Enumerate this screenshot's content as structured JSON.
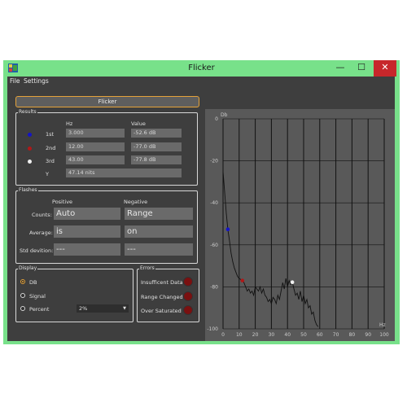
{
  "window": {
    "title": "Flicker",
    "minimize_glyph": "—",
    "maximize_glyph": "☐",
    "close_glyph": "✕"
  },
  "menu": {
    "file": "File",
    "settings": "Settings"
  },
  "flicker_button": "Flicker",
  "results": {
    "label": "Results",
    "col_hz": "Hz",
    "col_value": "Value",
    "rows": [
      {
        "name": "1st",
        "hz": "3.000",
        "value": "-52.6 dB",
        "color": "#1414c8"
      },
      {
        "name": "2nd",
        "hz": "12.00",
        "value": "-77.0 dB",
        "color": "#b01818"
      },
      {
        "name": "3rd",
        "hz": "43.00",
        "value": "-77.8 dB",
        "color": "#f0f0f0"
      }
    ],
    "y_label": "Y",
    "y_value": "47.14 nits"
  },
  "flashes": {
    "label": "Flashes",
    "col_positive": "Positive",
    "col_negative": "Negative",
    "counts_label": "Counts:",
    "counts_pos": "Auto",
    "counts_neg": "Range",
    "average_label": "Average:",
    "average_pos": "is",
    "average_neg": "on",
    "std_label": "Std devition:",
    "std_pos": "---",
    "std_neg": "---"
  },
  "display": {
    "label": "Display",
    "options": [
      "DB",
      "Signal",
      "Percent"
    ],
    "selected": "DB",
    "percent_value": "2%"
  },
  "errors": {
    "label": "Errors",
    "items": [
      "Insufficent Data",
      "Range Changed",
      "Over Saturated"
    ]
  },
  "chart_data": {
    "type": "line",
    "ylabel": "Db",
    "xlabel": "Hz",
    "xlim": [
      0,
      100
    ],
    "ylim": [
      -100,
      0
    ],
    "xticks": [
      0,
      10,
      20,
      30,
      40,
      50,
      60,
      70,
      80,
      90,
      100
    ],
    "yticks": [
      0,
      -20,
      -40,
      -60,
      -80,
      -100
    ],
    "grid": true,
    "series": [
      {
        "points": [
          [
            0,
            -25
          ],
          [
            1,
            -35
          ],
          [
            2,
            -45
          ],
          [
            3,
            -52.6
          ],
          [
            4,
            -58
          ],
          [
            5,
            -64
          ],
          [
            6,
            -68
          ],
          [
            7,
            -71
          ],
          [
            8,
            -73
          ],
          [
            9,
            -75
          ],
          [
            10,
            -76
          ],
          [
            11,
            -76.5
          ],
          [
            12,
            -77.0
          ],
          [
            13,
            -78
          ],
          [
            14,
            -80
          ],
          [
            15,
            -82
          ],
          [
            16,
            -81
          ],
          [
            17,
            -83
          ],
          [
            18,
            -82
          ],
          [
            19,
            -84
          ],
          [
            20,
            -80
          ],
          [
            21,
            -81
          ],
          [
            22,
            -82
          ],
          [
            23,
            -80
          ],
          [
            24,
            -83
          ],
          [
            25,
            -81
          ],
          [
            26,
            -84
          ],
          [
            27,
            -85
          ],
          [
            28,
            -87
          ],
          [
            29,
            -86
          ],
          [
            30,
            -88
          ],
          [
            31,
            -85
          ],
          [
            32,
            -86
          ],
          [
            33,
            -88
          ],
          [
            34,
            -84
          ],
          [
            35,
            -86
          ],
          [
            36,
            -82
          ],
          [
            37,
            -78
          ],
          [
            38,
            -81
          ],
          [
            39,
            -76
          ],
          [
            40,
            -80
          ],
          [
            41,
            -77
          ],
          [
            42,
            -79
          ],
          [
            43,
            -77.8
          ],
          [
            44,
            -81
          ],
          [
            45,
            -84
          ],
          [
            46,
            -83
          ],
          [
            47,
            -86
          ],
          [
            48,
            -82
          ],
          [
            49,
            -87
          ],
          [
            50,
            -84
          ],
          [
            51,
            -88
          ],
          [
            52,
            -86
          ],
          [
            53,
            -90
          ],
          [
            54,
            -89
          ],
          [
            55,
            -93
          ],
          [
            56,
            -92
          ],
          [
            57,
            -96
          ],
          [
            58,
            -98
          ],
          [
            59,
            -99
          ]
        ]
      }
    ],
    "markers": [
      {
        "x": 3,
        "y": -52.6,
        "color": "#1414c8"
      },
      {
        "x": 12,
        "y": -77.0,
        "color": "#b01818"
      },
      {
        "x": 43,
        "y": -77.8,
        "color": "#f0f0f0"
      }
    ],
    "colors": {
      "plot_bg": "#595959",
      "grid": "#111111",
      "line": "#111111",
      "axis_text": "#cccccc"
    }
  }
}
